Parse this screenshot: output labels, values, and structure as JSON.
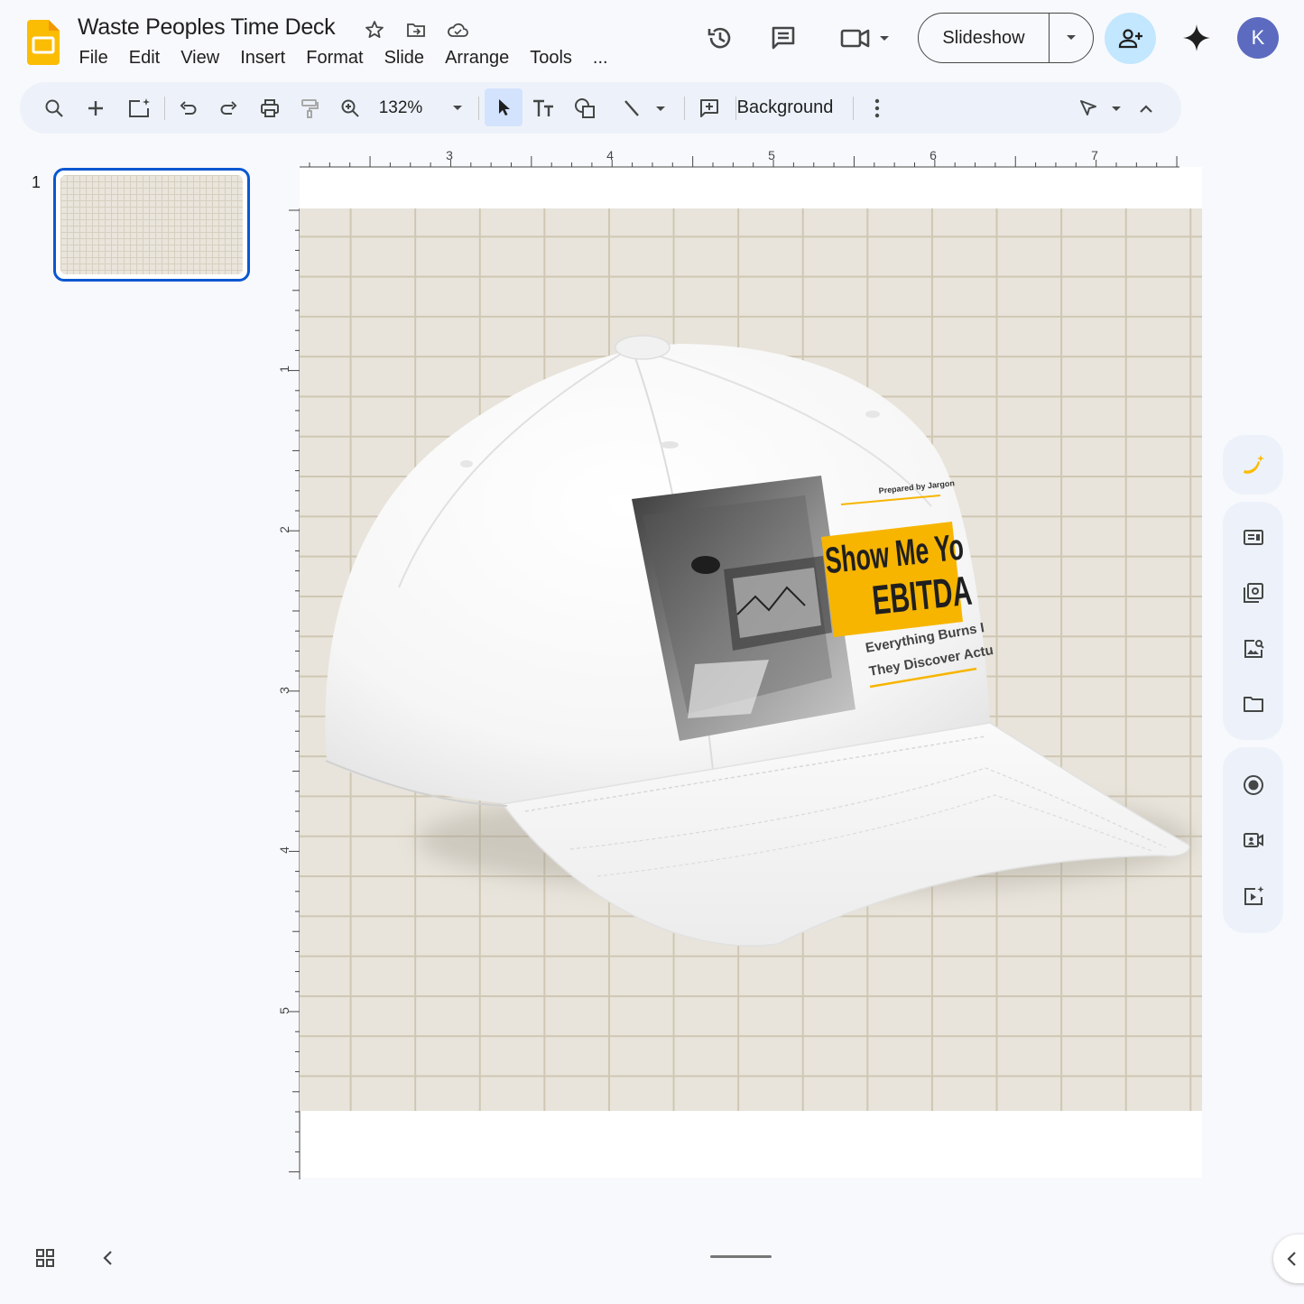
{
  "app": {
    "name": "Google Slides",
    "brand_color": "#fbbc04",
    "accent": "#0b57d0"
  },
  "document": {
    "title": "Waste Peoples Time Deck"
  },
  "title_icons": [
    "star-icon",
    "move-to-folder-icon",
    "cloud-saved-icon"
  ],
  "menu": [
    "File",
    "Edit",
    "View",
    "Insert",
    "Format",
    "Slide",
    "Arrange",
    "Tools",
    "..."
  ],
  "header": {
    "slideshow_label": "Slideshow",
    "avatar_letter": "K"
  },
  "toolbar": {
    "zoom": "132%",
    "background_label": "Background"
  },
  "filmstrip": {
    "slides": [
      {
        "number": "1",
        "selected": true
      }
    ]
  },
  "ruler": {
    "horizontal_labels": [
      "3",
      "4",
      "5",
      "6",
      "7"
    ],
    "vertical_labels": [
      "1",
      "2",
      "3",
      "4",
      "5"
    ]
  },
  "slide": {
    "background": "beige grid",
    "image": {
      "subject": "white baseball cap with printed patch",
      "patch": {
        "prepared_by": "Prepared by Jargon",
        "headline_line1": "Show Me Yo",
        "headline_line2": "EBITDA",
        "subline1": "Everything Burns I",
        "subline2": "They Discover Actu",
        "accent_color": "#f7b500"
      }
    }
  },
  "side_panel_icons": [
    "banana-sparkle-icon",
    "layout-icon",
    "slide-library-icon",
    "image-search-icon",
    "folder-icon",
    "record-icon",
    "camera-icon",
    "video-sparkle-icon"
  ]
}
